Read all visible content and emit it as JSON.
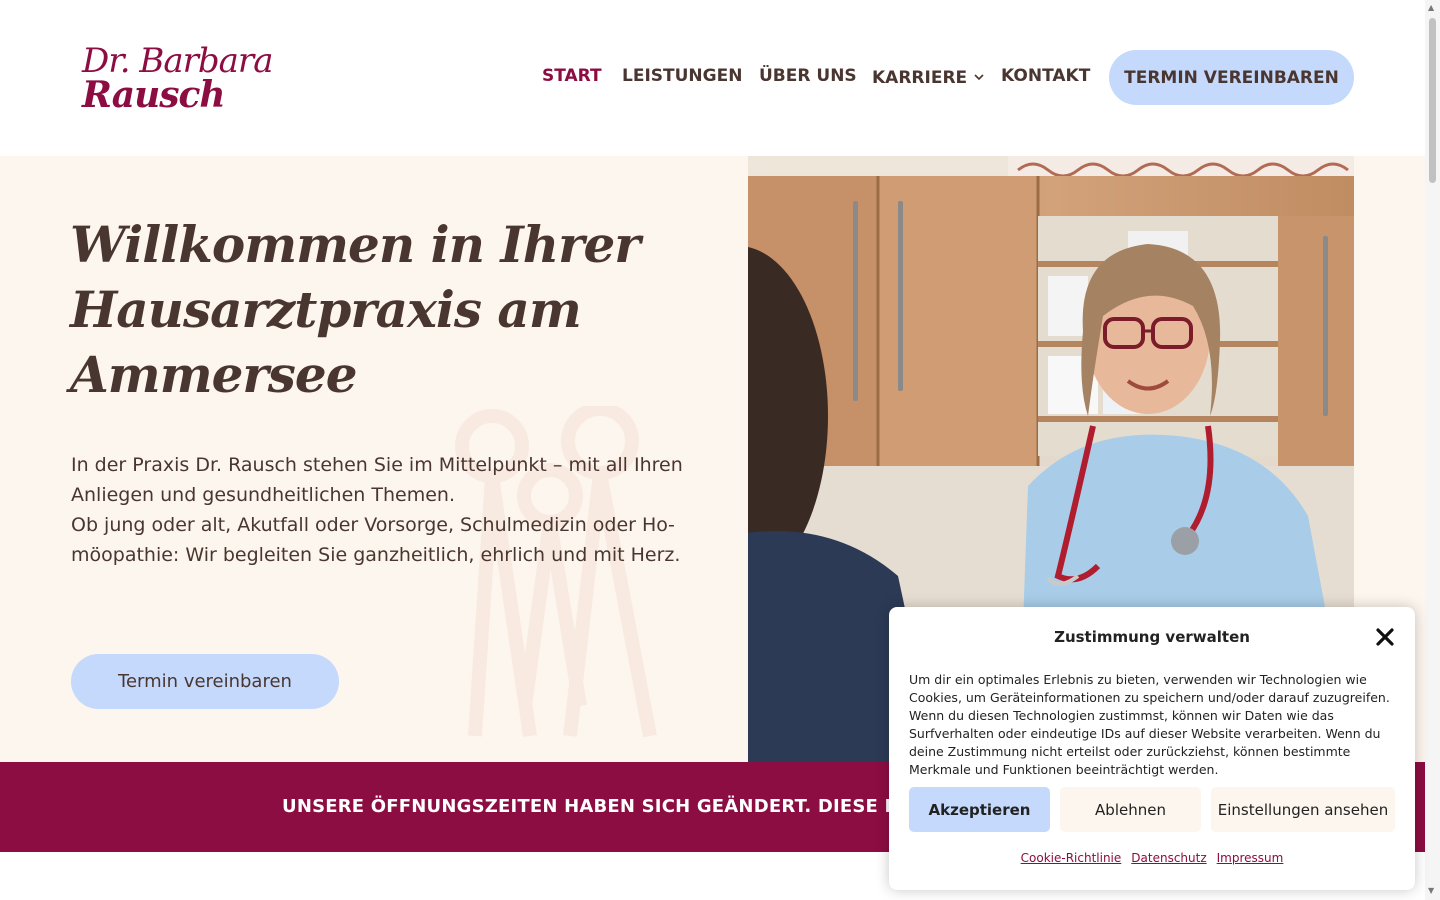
{
  "brand": {
    "logo_line1": "Dr. Barbara",
    "logo_line2": "Rausch",
    "accent_color": "#8c0d42",
    "button_color": "#c4d9fb",
    "hero_bg": "#fdf6ee"
  },
  "nav": {
    "items": [
      {
        "label": "START",
        "active": true
      },
      {
        "label": "LEISTUNGEN",
        "active": false
      },
      {
        "label": "ÜBER UNS",
        "active": false
      },
      {
        "label": "KARRIERE",
        "active": false,
        "has_dropdown": true
      },
      {
        "label": "KONTAKT",
        "active": false
      }
    ],
    "cta_label": "TERMIN VEREINBAREN"
  },
  "hero": {
    "title": "Willkommen in Ihrer Hausarztpraxis am Ammersee",
    "paragraph_1": "In der Praxis Dr. Rausch stehen Sie im Mittelpunkt – mit all Ihren Anliegen und gesundheitlichen Themen.",
    "paragraph_2": "Ob jung oder alt, Akutfall oder Vorsorge, Schulmedizin oder Ho­möopathie: Wir begleiten Sie ganzheitlich, ehrlich und mit Herz.",
    "button_label": "Termin vereinbaren"
  },
  "banner": {
    "text": "UNSERE ÖFFNUNGSZEITEN HABEN SICH GEÄNDERT. DIESE FINDEN S"
  },
  "cookie": {
    "title": "Zustimmung verwalten",
    "body": "Um dir ein optimales Erlebnis zu bieten, verwenden wir Technologien wie Cookies, um Geräteinformationen zu speichern und/oder darauf zuzugreifen. Wenn du diesen Technologien zustimmst, können wir Daten wie das Surfverhalten oder eindeutige IDs auf dieser Website verarbeiten. Wenn du deine Zustimmung nicht erteilst oder zurückziehst, können bestimmte Merkmale und Funktionen beeinträchtigt werden.",
    "accept_label": "Akzeptieren",
    "deny_label": "Ablehnen",
    "prefs_label": "Einstellungen ansehen",
    "links": [
      "Cookie-Richtlinie",
      "Datenschutz",
      "Impressum"
    ]
  }
}
